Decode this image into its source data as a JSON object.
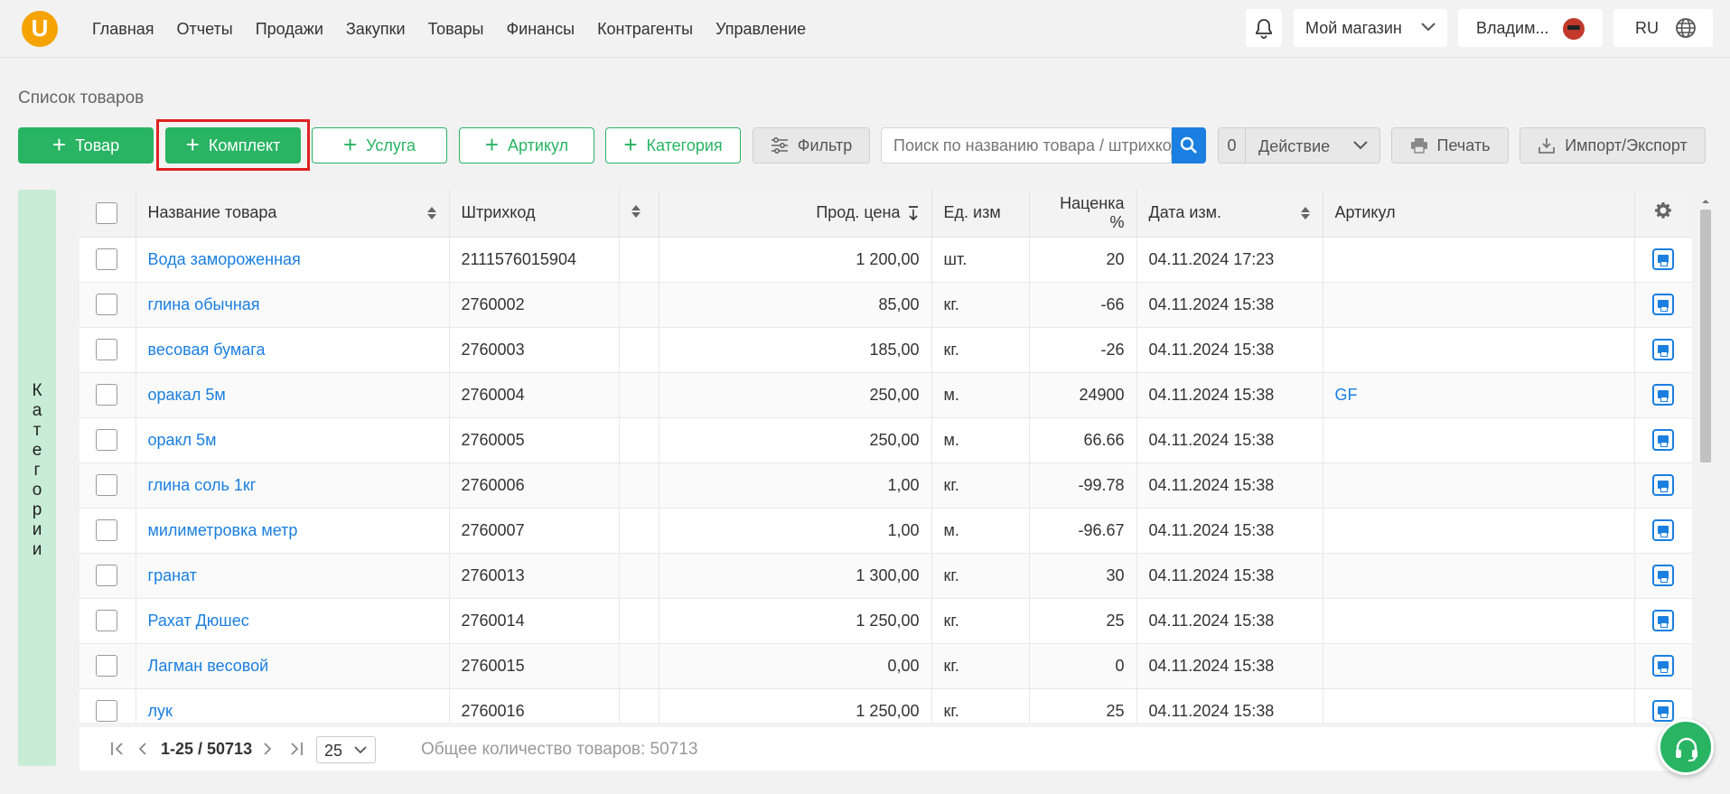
{
  "logo": {
    "letter": "U"
  },
  "nav": [
    "Главная",
    "Отчеты",
    "Продажи",
    "Закупки",
    "Товары",
    "Финансы",
    "Контрагенты",
    "Управление"
  ],
  "header": {
    "store": "Мой магазин",
    "user": "Владим...",
    "lang": "RU"
  },
  "page": {
    "title": "Список товаров"
  },
  "toolbar": {
    "add_product": "Товар",
    "add_kit": "Комплект",
    "add_service": "Услуга",
    "add_article": "Артикул",
    "add_category": "Категория",
    "filter": "Фильтр",
    "search_placeholder": "Поиск по названию товара / штрихкоду",
    "action_count": "0",
    "action": "Действие",
    "print": "Печать",
    "import_export": "Импорт/Экспорт"
  },
  "sidebar": {
    "categories_tab": "Категории"
  },
  "table": {
    "columns": {
      "name": "Название товара",
      "barcode": "Штрихкод",
      "price": "Прод. цена",
      "unit": "Ед. изм",
      "markup": "Наценка %",
      "date": "Дата изм.",
      "article": "Артикул"
    },
    "rows": [
      {
        "name": "Вода замороженная",
        "barcode": "2111576015904",
        "price": "1 200,00",
        "unit": "шт.",
        "markup": "20",
        "date": "04.11.2024 17:23",
        "article": ""
      },
      {
        "name": "глина обычная",
        "barcode": "2760002",
        "price": "85,00",
        "unit": "кг.",
        "markup": "-66",
        "date": "04.11.2024 15:38",
        "article": ""
      },
      {
        "name": "весовая бумага",
        "barcode": "2760003",
        "price": "185,00",
        "unit": "кг.",
        "markup": "-26",
        "date": "04.11.2024 15:38",
        "article": ""
      },
      {
        "name": "оракал 5м",
        "barcode": "2760004",
        "price": "250,00",
        "unit": "м.",
        "markup": "24900",
        "date": "04.11.2024 15:38",
        "article": "GF"
      },
      {
        "name": "оракл 5м",
        "barcode": "2760005",
        "price": "250,00",
        "unit": "м.",
        "markup": "66.66",
        "date": "04.11.2024 15:38",
        "article": ""
      },
      {
        "name": "глина соль 1кг",
        "barcode": "2760006",
        "price": "1,00",
        "unit": "кг.",
        "markup": "-99.78",
        "date": "04.11.2024 15:38",
        "article": ""
      },
      {
        "name": "милиметровка метр",
        "barcode": "2760007",
        "price": "1,00",
        "unit": "м.",
        "markup": "-96.67",
        "date": "04.11.2024 15:38",
        "article": ""
      },
      {
        "name": "гранат",
        "barcode": "2760013",
        "price": "1 300,00",
        "unit": "кг.",
        "markup": "30",
        "date": "04.11.2024 15:38",
        "article": ""
      },
      {
        "name": "Рахат Дюшес",
        "barcode": "2760014",
        "price": "1 250,00",
        "unit": "кг.",
        "markup": "25",
        "date": "04.11.2024 15:38",
        "article": ""
      },
      {
        "name": "Лагман весовой",
        "barcode": "2760015",
        "price": "0,00",
        "unit": "кг.",
        "markup": "0",
        "date": "04.11.2024 15:38",
        "article": ""
      },
      {
        "name": "лук",
        "barcode": "2760016",
        "price": "1 250,00",
        "unit": "кг.",
        "markup": "25",
        "date": "04.11.2024 15:38",
        "article": ""
      }
    ]
  },
  "pagination": {
    "range": "1-25 / 50713",
    "page_size": "25",
    "total": "Общее количество товаров: 50713"
  },
  "colors": {
    "accent_green": "#28b463",
    "link_blue": "#1a7fe0",
    "highlight_red": "#e02020"
  },
  "icons": [
    "bell-icon",
    "chevron-down-icon",
    "globe-icon",
    "plus-icon",
    "filter-icon",
    "search-icon",
    "print-icon",
    "import-export-icon",
    "gear-icon",
    "sort-icon",
    "headset-icon"
  ]
}
